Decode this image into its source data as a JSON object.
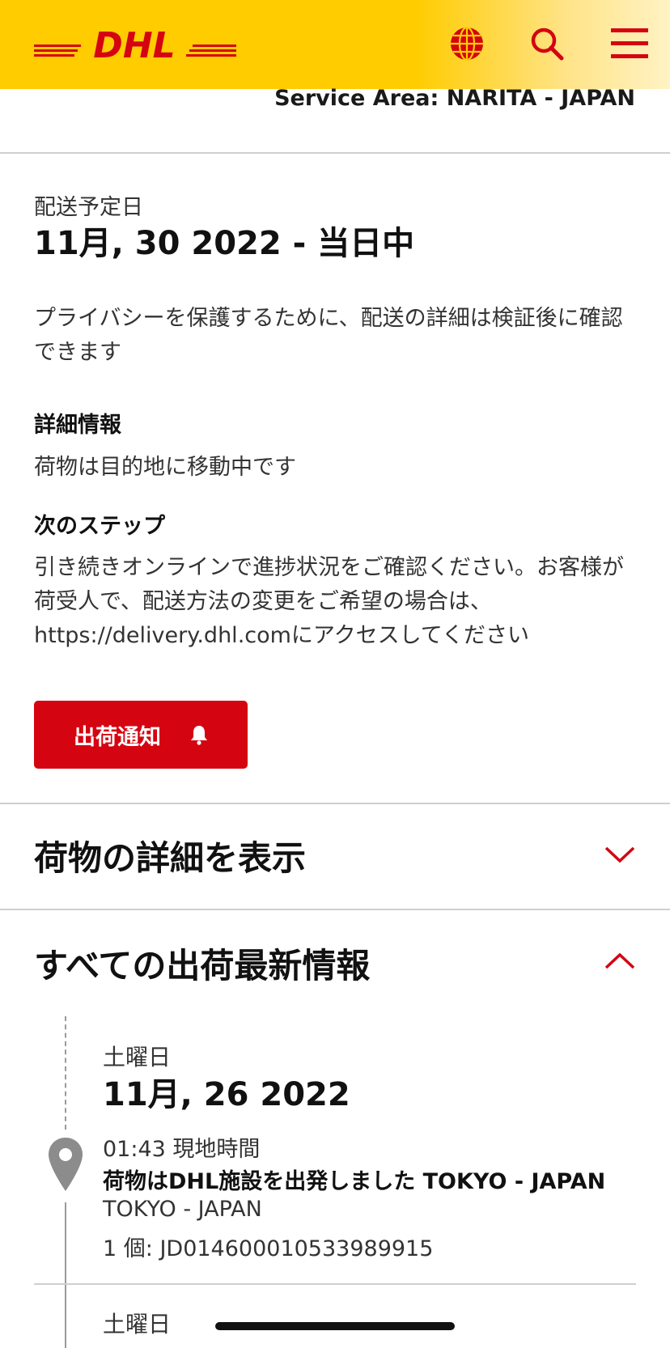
{
  "header": {
    "logo_text": "DHL",
    "icons": [
      "globe-icon",
      "search-icon",
      "hamburger-menu-icon"
    ],
    "accent": "#d40511",
    "bg": "#ffcc00"
  },
  "service_area": "Service Area: NARITA - JAPAN",
  "delivery": {
    "label": "配送予定日",
    "date": "11月, 30 2022 - 当日中",
    "privacy_note": "プライバシーを保護するために、配送の詳細は検証後に確認できます"
  },
  "details": {
    "heading": "詳細情報",
    "text": "荷物は目的地に移動中です"
  },
  "next_step": {
    "heading": "次のステップ",
    "text": "引き続きオンラインで進捗状況をご確認ください。お客様が荷受人で、配送方法の変更をご希望の場合は、https://delivery.dhl.comにアクセスしてください"
  },
  "notify_button": {
    "label": "出荷通知",
    "icon": "bell-icon"
  },
  "sections": {
    "shipment_details": "荷物の詳細を表示",
    "all_updates": "すべての出荷最新情報"
  },
  "events": [
    {
      "day": "土曜日",
      "date": "11月, 26 2022",
      "time": "01:43 現地時間",
      "status": "荷物はDHL施設を出発しました TOKYO - JAPAN",
      "location": "TOKYO - JAPAN",
      "piece": "1 個: JD014600010533989915"
    },
    {
      "day": "土曜日"
    }
  ]
}
